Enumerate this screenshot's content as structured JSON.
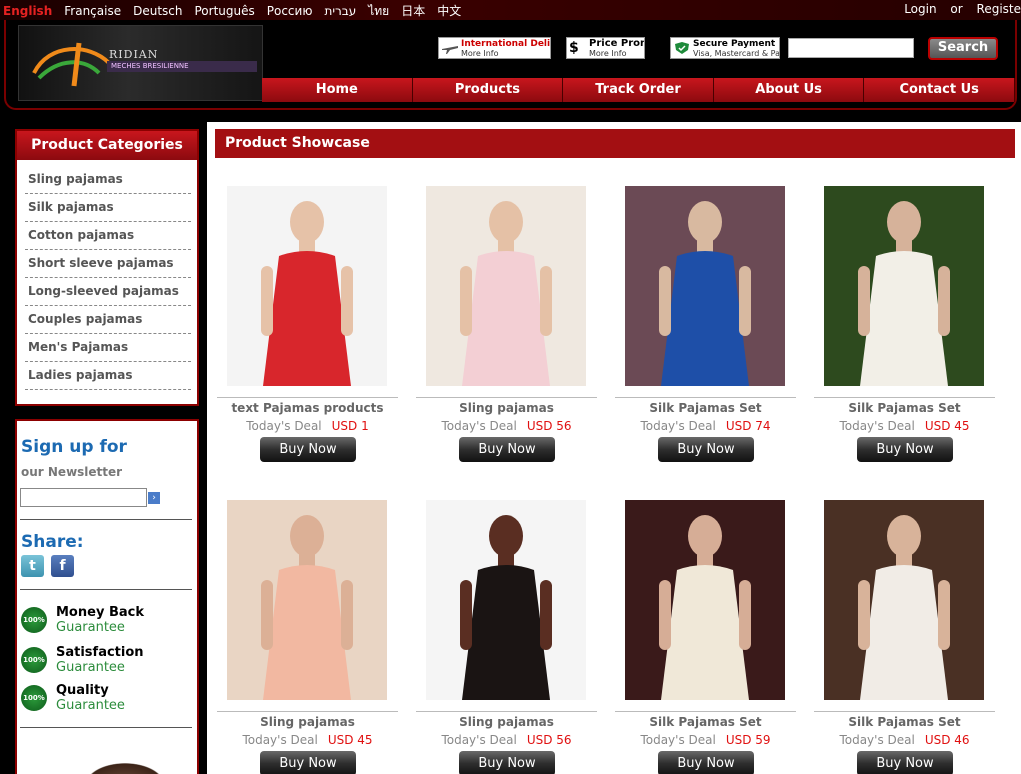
{
  "languages": [
    {
      "label": "English",
      "active": true
    },
    {
      "label": "Française",
      "active": false
    },
    {
      "label": "Deutsch",
      "active": false
    },
    {
      "label": "Português",
      "active": false
    },
    {
      "label": "Россию",
      "active": false
    },
    {
      "label": "עברית",
      "active": false
    },
    {
      "label": "ไทย",
      "active": false
    },
    {
      "label": "日本",
      "active": false
    },
    {
      "label": "中文",
      "active": false
    }
  ],
  "account": {
    "login": "Login",
    "or": "or",
    "register": "Registe"
  },
  "logo": {
    "name": "RIDIAN",
    "subtitle": "MECHES BRESILIENNE"
  },
  "promos": [
    {
      "line1": "International Delivery",
      "line2": "More Info",
      "icon": "airplane-icon"
    },
    {
      "line1": "Price Promi",
      "line2": "More Info",
      "icon": "dollar-icon"
    },
    {
      "line1": "Secure Payment",
      "line2": "Visa, Mastercard & Pa",
      "icon": "shield-icon"
    }
  ],
  "search": {
    "placeholder": "",
    "button_label": "Search"
  },
  "nav": [
    "Home",
    "Products",
    "Track Order",
    "About Us",
    "Contact Us"
  ],
  "sidebar": {
    "categories_title": "Product Categories",
    "categories": [
      "Sling pajamas",
      "Silk pajamas",
      "Cotton pajamas",
      "Short sleeve pajamas",
      "Long-sleeved pajamas",
      "Couples pajamas",
      "Men's Pajamas",
      "Ladies pajamas"
    ],
    "newsletter_title": "Sign up for",
    "newsletter_sub": "our Newsletter",
    "go_label": "›",
    "share_title": "Share:",
    "twitter_glyph": "t",
    "facebook_glyph": "f",
    "guarantees": [
      {
        "badge": "100%",
        "line1": "Money Back",
        "line2": "Guarantee"
      },
      {
        "badge": "100%",
        "line1": "Satisfaction",
        "line2": "Guarantee"
      },
      {
        "badge": "100%",
        "line1": "Quality",
        "line2": "Guarantee"
      }
    ]
  },
  "showcase": {
    "title": "Product Showcase",
    "deal_label": "Today's Deal",
    "buy_label": "Buy Now",
    "products": [
      {
        "name": "text Pajamas products",
        "price": "USD 1",
        "colors": [
          "#f4f4f4",
          "#d8262c",
          "#e6c2a8"
        ]
      },
      {
        "name": "Sling pajamas",
        "price": "USD 56",
        "colors": [
          "#efe8e0",
          "#f3cfd4",
          "#e5c1a6"
        ]
      },
      {
        "name": "Silk Pajamas Set",
        "price": "USD 74",
        "colors": [
          "#6b4a55",
          "#1e4fa8",
          "#d8b9a0"
        ]
      },
      {
        "name": "Silk Pajamas Set",
        "price": "USD 45",
        "colors": [
          "#2d4a1e",
          "#f2efe7",
          "#d6b29a"
        ]
      },
      {
        "name": "Sling pajamas",
        "price": "USD 45",
        "colors": [
          "#e9d5c4",
          "#f2b8a1",
          "#dcb096"
        ]
      },
      {
        "name": "Sling pajamas",
        "price": "USD 56",
        "colors": [
          "#f5f5f5",
          "#1a1413",
          "#5a2e22"
        ]
      },
      {
        "name": "Silk Pajamas Set",
        "price": "USD 59",
        "colors": [
          "#3a1a1a",
          "#f0e8d8",
          "#d6ad96"
        ]
      },
      {
        "name": "Silk Pajamas Set",
        "price": "USD 46",
        "colors": [
          "#4a3024",
          "#f1ece6",
          "#d8b39a"
        ]
      }
    ]
  }
}
